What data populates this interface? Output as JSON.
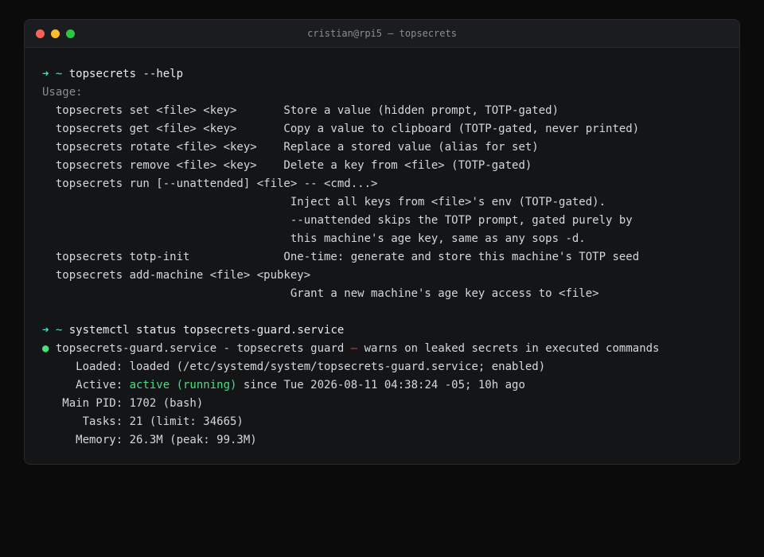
{
  "window": {
    "title": "cristian@rpi5 — topsecrets"
  },
  "prompt": {
    "arrow": "➜",
    "cwd": "~"
  },
  "session": [
    {
      "type": "prompt",
      "command": "topsecrets --help"
    },
    {
      "type": "dim",
      "text": "Usage:"
    },
    {
      "type": "text",
      "text": "  topsecrets set <file> <key>       Store a value (hidden prompt, TOTP-gated)"
    },
    {
      "type": "text",
      "text": "  topsecrets get <file> <key>       Copy a value to clipboard (TOTP-gated, never printed)"
    },
    {
      "type": "text",
      "text": "  topsecrets rotate <file> <key>    Replace a stored value (alias for set)"
    },
    {
      "type": "text",
      "text": "  topsecrets remove <file> <key>    Delete a key from <file> (TOTP-gated)"
    },
    {
      "type": "text",
      "text": "  topsecrets run [--unattended] <file> -- <cmd...>"
    },
    {
      "type": "text",
      "text": "                                     Inject all keys from <file>'s env (TOTP-gated)."
    },
    {
      "type": "text",
      "text": "                                     --unattended skips the TOTP prompt, gated purely by"
    },
    {
      "type": "text",
      "text": "                                     this machine's age key, same as any sops -d."
    },
    {
      "type": "text",
      "text": "  topsecrets totp-init              One-time: generate and store this machine's TOTP seed"
    },
    {
      "type": "text",
      "text": "  topsecrets add-machine <file> <pubkey>"
    },
    {
      "type": "text",
      "text": "                                     Grant a new machine's age key access to <file>"
    },
    {
      "type": "blank",
      "text": ""
    },
    {
      "type": "prompt",
      "command": "systemctl status topsecrets-guard.service"
    },
    {
      "type": "service",
      "dot": "●",
      "name": "topsecrets-guard.service - topsecrets guard",
      "dash": "—",
      "desc": "warns on leaked secrets in executed commands"
    },
    {
      "type": "text",
      "text": "     Loaded: loaded (/etc/systemd/system/topsecrets-guard.service; enabled)"
    },
    {
      "type": "active",
      "label": "     Active: ",
      "state": "active (running)",
      "rest": " since Tue 2026-08-11 04:38:24 -05; 10h ago"
    },
    {
      "type": "text",
      "text": "   Main PID: 1702 (bash)"
    },
    {
      "type": "text",
      "text": "      Tasks: 21 (limit: 34665)"
    },
    {
      "type": "text",
      "text": "     Memory: 26.3M (peak: 99.3M)"
    }
  ],
  "colors": {
    "accent_prompt": "#5fd7c0",
    "status_active": "#4ade80",
    "dash_red": "#e0443e"
  }
}
